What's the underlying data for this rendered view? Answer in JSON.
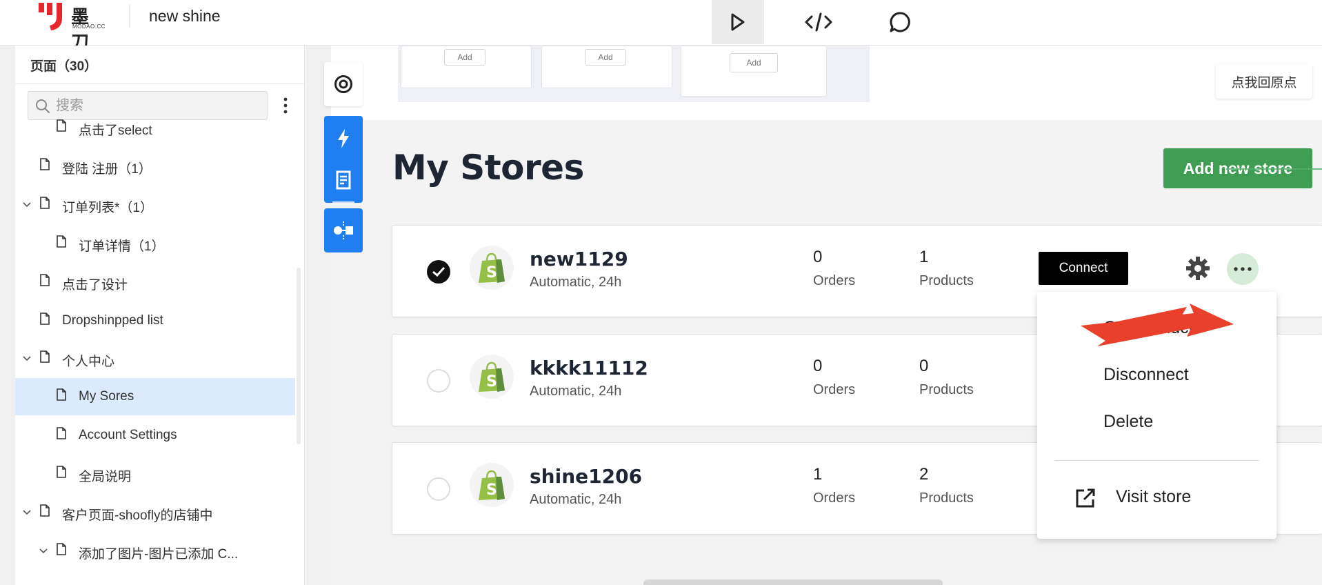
{
  "app": {
    "logo_cn": "墨刀",
    "logo_en": "MODAO.CC",
    "project_name": "new shine"
  },
  "toolbar": {
    "icons": [
      "play-icon",
      "code-icon",
      "comment-icon"
    ]
  },
  "sidebar": {
    "pages_header": "页面（30）",
    "search_placeholder": "搜索",
    "items": [
      {
        "label": "点击了select",
        "level": 1,
        "expandable": false,
        "selected": false
      },
      {
        "label": "登陆 注册（1）",
        "level": 0,
        "expandable": false,
        "selected": false
      },
      {
        "label": "订单列表*（1）",
        "level": 0,
        "expandable": true,
        "selected": false
      },
      {
        "label": "订单详情（1）",
        "level": 1,
        "expandable": false,
        "selected": false
      },
      {
        "label": "点击了设计",
        "level": 0,
        "expandable": false,
        "selected": false
      },
      {
        "label": "Dropshinpped list",
        "level": 0,
        "expandable": false,
        "selected": false
      },
      {
        "label": "个人中心",
        "level": 0,
        "expandable": true,
        "selected": false
      },
      {
        "label": "My Sores",
        "level": 1,
        "expandable": false,
        "selected": true
      },
      {
        "label": "Account Settings",
        "level": 1,
        "expandable": false,
        "selected": false
      },
      {
        "label": "全局说明",
        "level": 1,
        "expandable": false,
        "selected": false
      },
      {
        "label": "客户页面-shoofly的店铺中",
        "level": 0,
        "expandable": true,
        "selected": false
      },
      {
        "label": "添加了图片-图片已添加 C...",
        "level": 1,
        "expandable": true,
        "selected": false
      }
    ]
  },
  "canvas": {
    "mini_cards": [
      {
        "add_label": "Add"
      },
      {
        "add_label": "Add"
      },
      {
        "add_label": "Add"
      }
    ],
    "origin_button": "点我回原点",
    "side_tools": [
      "target-icon",
      "bolt-icon",
      "document-icon",
      "component-icon"
    ]
  },
  "stores_page": {
    "title": "My Stores",
    "add_button": "Add new store",
    "connect_label": "Connect",
    "orders_label": "Orders",
    "products_label": "Products",
    "stores": [
      {
        "name": "new1129",
        "sync": "Automatic, 24h",
        "orders": "0",
        "products": "1",
        "selected": true
      },
      {
        "name": "kkkk11112",
        "sync": "Automatic, 24h",
        "orders": "0",
        "products": "0",
        "selected": false
      },
      {
        "name": "shine1206",
        "sync": "Automatic, 24h",
        "orders": "1",
        "products": "2",
        "selected": false
      }
    ],
    "menu": {
      "partial_item": "Get products",
      "disconnect": "Disconnect",
      "delete": "Delete",
      "visit_store": "Visit store"
    }
  },
  "colors": {
    "brand_red": "#e8262e",
    "primary_blue": "#1f7ff0",
    "green": "#3e9c53",
    "selected_bg": "#dbeafd",
    "annotation_red": "#e8402a"
  }
}
